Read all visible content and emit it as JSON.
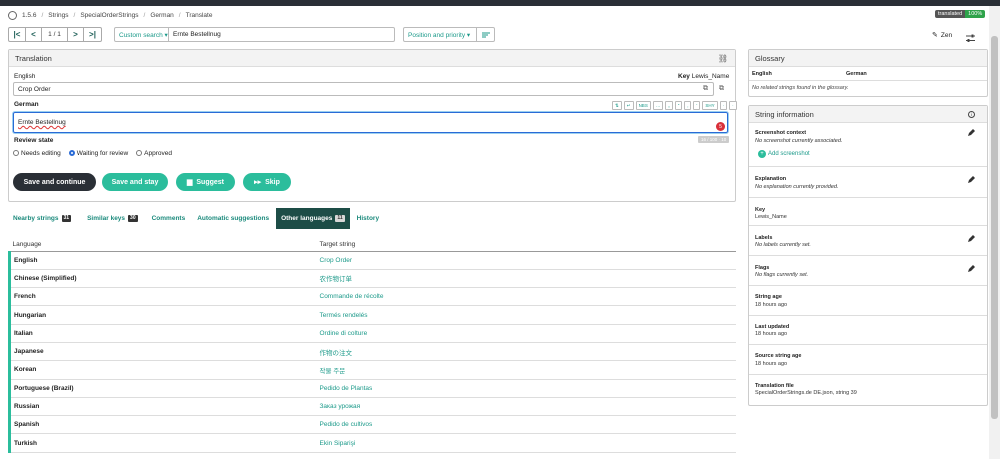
{
  "breadcrumb": {
    "items": [
      "1.5.6",
      "Strings",
      "SpecialOrderStrings",
      "German",
      "Translate"
    ]
  },
  "translated_badge": {
    "label": "translated",
    "value": "100%"
  },
  "nav": {
    "first": "|<",
    "prev": "<",
    "position": "1 / 1",
    "next": ">",
    "last": ">|"
  },
  "search": {
    "mode": "Custom search ▾",
    "value": "Ernte Bestellnug"
  },
  "sort": {
    "label": "Position and priority ▾"
  },
  "zen": {
    "label": "Zen"
  },
  "translation_panel": {
    "title": "Translation",
    "source_lang": "English",
    "key_label": "Key",
    "key_value": "Lewis_Name",
    "source_text": "Crop Order",
    "target_lang": "German",
    "target_text": "Ernte Bestellnug",
    "char_counter": "16 / 100 · 10",
    "toolbar": [
      "⇅",
      "↵",
      "NBS",
      "…",
      "„",
      "“",
      "‚",
      "‘",
      "SHY",
      "·",
      "·"
    ],
    "error_count": "5",
    "review_state_label": "Review state",
    "review_options": [
      "Needs editing",
      "Waiting for review",
      "Approved"
    ],
    "review_selected": "Waiting for review"
  },
  "actions": {
    "save_continue": "Save and continue",
    "save_stay": "Save and stay",
    "suggest": "Suggest",
    "skip": "Skip"
  },
  "tabs": [
    {
      "label": "Nearby strings",
      "count": "31"
    },
    {
      "label": "Similar keys",
      "count": "30"
    },
    {
      "label": "Comments",
      "count": ""
    },
    {
      "label": "Automatic suggestions",
      "count": ""
    },
    {
      "label": "Other languages",
      "count": "11"
    },
    {
      "label": "History",
      "count": ""
    }
  ],
  "other_languages": {
    "headers": [
      "Language",
      "Target string"
    ],
    "rows": [
      {
        "language": "English",
        "target": "Crop Order"
      },
      {
        "language": "Chinese (Simplified)",
        "target": "农作物订单"
      },
      {
        "language": "French",
        "target": "Commande de récolte"
      },
      {
        "language": "Hungarian",
        "target": "Termés rendelés"
      },
      {
        "language": "Italian",
        "target": "Ordine di colture"
      },
      {
        "language": "Japanese",
        "target": "作物の注文"
      },
      {
        "language": "Korean",
        "target": "작물 주문"
      },
      {
        "language": "Portuguese (Brazil)",
        "target": "Pedido de Plantas"
      },
      {
        "language": "Russian",
        "target": "Заказ урожая"
      },
      {
        "language": "Spanish",
        "target": "Pedido de cultivos"
      },
      {
        "language": "Turkish",
        "target": "Ekin Siparişi"
      }
    ]
  },
  "glossary": {
    "title": "Glossary",
    "col_en": "English",
    "col_de": "German",
    "empty": "No related strings found in the glossary."
  },
  "string_info": {
    "title": "String information",
    "screenshot_context": "Screenshot context",
    "screenshot_empty": "No screenshot currently associated.",
    "add_screenshot": "Add screenshot",
    "explanation": "Explanation",
    "explanation_empty": "No explanation currently provided.",
    "key": "Key",
    "key_value": "Lewis_Name",
    "labels": "Labels",
    "labels_empty": "No labels currently set.",
    "flags": "Flags",
    "flags_empty": "No flags currently set.",
    "string_age": "String age",
    "string_age_value": "18 hours ago",
    "last_updated": "Last updated",
    "last_updated_value": "18 hours ago",
    "source_age": "Source string age",
    "source_age_value": "18 hours ago",
    "translation_file": "Translation file",
    "translation_file_value": "SpecialOrderStrings.de DE.json, string 39"
  },
  "colors": {
    "teal": "#1c9a8a",
    "dark_teal": "#1d4d47",
    "button_teal": "#2bbd9c",
    "dark_button": "#2a2f36",
    "badge_green": "#2ea34a"
  }
}
